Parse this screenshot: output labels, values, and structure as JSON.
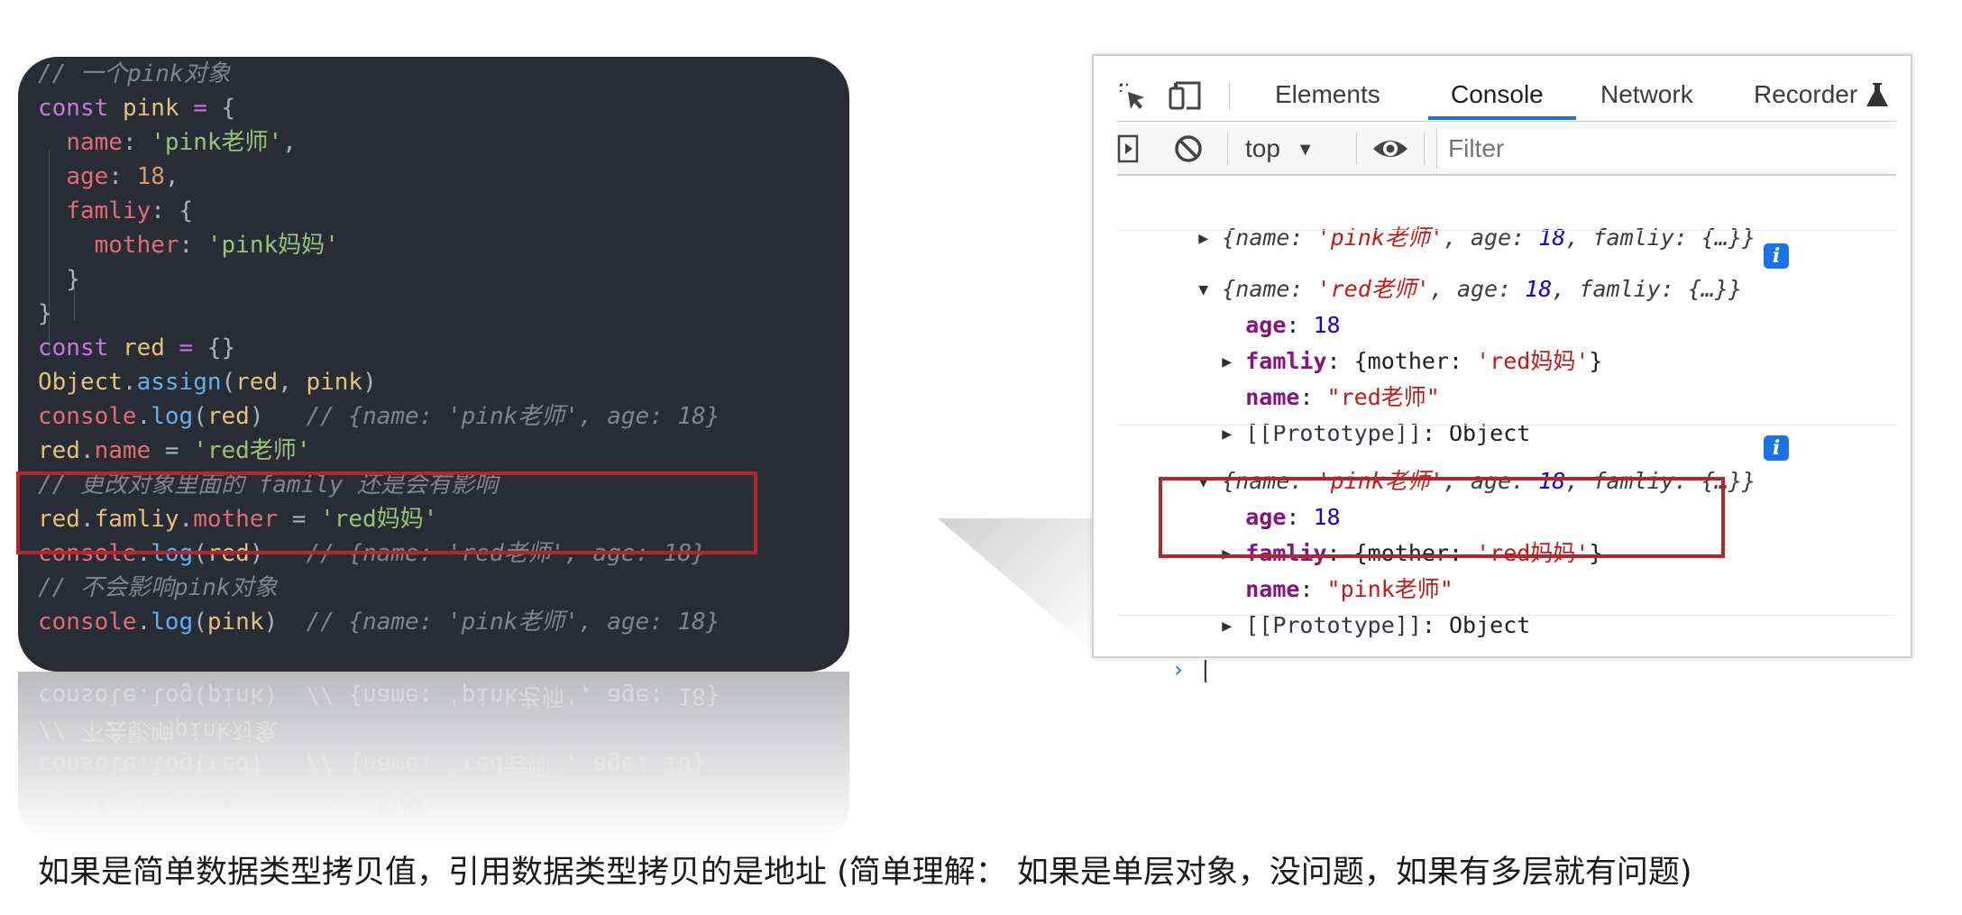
{
  "code": {
    "lines": [
      [
        {
          "t": "// 一个pink对象",
          "c": "cm"
        }
      ],
      [
        {
          "t": "const",
          "c": "kw"
        },
        {
          "t": " ",
          "c": "pun"
        },
        {
          "t": "pink",
          "c": "var"
        },
        {
          "t": " ",
          "c": "pun"
        },
        {
          "t": "=",
          "c": "kw"
        },
        {
          "t": " {",
          "c": "pun"
        }
      ],
      [
        {
          "t": "  ",
          "c": "pun"
        },
        {
          "t": "name",
          "c": "prop"
        },
        {
          "t": ": ",
          "c": "pun"
        },
        {
          "t": "'pink老师'",
          "c": "str"
        },
        {
          "t": ",",
          "c": "pun"
        }
      ],
      [
        {
          "t": "  ",
          "c": "pun"
        },
        {
          "t": "age",
          "c": "prop"
        },
        {
          "t": ": ",
          "c": "pun"
        },
        {
          "t": "18",
          "c": "num"
        },
        {
          "t": ",",
          "c": "pun"
        }
      ],
      [
        {
          "t": "  ",
          "c": "pun"
        },
        {
          "t": "famliy",
          "c": "prop"
        },
        {
          "t": ": {",
          "c": "pun"
        }
      ],
      [
        {
          "t": "    ",
          "c": "pun"
        },
        {
          "t": "mother",
          "c": "prop"
        },
        {
          "t": ": ",
          "c": "pun"
        },
        {
          "t": "'pink妈妈'",
          "c": "str"
        }
      ],
      [
        {
          "t": "  }",
          "c": "pun"
        }
      ],
      [
        {
          "t": "}",
          "c": "pun"
        }
      ],
      [
        {
          "t": "const",
          "c": "kw"
        },
        {
          "t": " ",
          "c": "pun"
        },
        {
          "t": "red",
          "c": "var"
        },
        {
          "t": " ",
          "c": "pun"
        },
        {
          "t": "=",
          "c": "kw"
        },
        {
          "t": " {}",
          "c": "pun"
        }
      ],
      [
        {
          "t": "Object",
          "c": "obj"
        },
        {
          "t": ".",
          "c": "pun"
        },
        {
          "t": "assign",
          "c": "fn"
        },
        {
          "t": "(",
          "c": "pun"
        },
        {
          "t": "red",
          "c": "var"
        },
        {
          "t": ", ",
          "c": "pun"
        },
        {
          "t": "pink",
          "c": "var"
        },
        {
          "t": ")",
          "c": "pun"
        }
      ],
      [
        {
          "t": "console",
          "c": "prop"
        },
        {
          "t": ".",
          "c": "pun"
        },
        {
          "t": "log",
          "c": "fn"
        },
        {
          "t": "(",
          "c": "pun"
        },
        {
          "t": "red",
          "c": "var"
        },
        {
          "t": ")   ",
          "c": "pun"
        },
        {
          "t": "// {name: 'pink老师', age: 18}",
          "c": "cm"
        }
      ],
      [
        {
          "t": "red",
          "c": "var"
        },
        {
          "t": ".",
          "c": "pun"
        },
        {
          "t": "name",
          "c": "prop"
        },
        {
          "t": " = ",
          "c": "pun"
        },
        {
          "t": "'red老师'",
          "c": "str"
        }
      ],
      [
        {
          "t": "// 更改对象里面的 family 还是会有影响",
          "c": "cm"
        }
      ],
      [
        {
          "t": "red",
          "c": "var"
        },
        {
          "t": ".",
          "c": "pun"
        },
        {
          "t": "famliy",
          "c": "var"
        },
        {
          "t": ".",
          "c": "pun"
        },
        {
          "t": "mother",
          "c": "prop"
        },
        {
          "t": " = ",
          "c": "pun"
        },
        {
          "t": "'red妈妈'",
          "c": "str"
        }
      ],
      [
        {
          "t": "console",
          "c": "prop"
        },
        {
          "t": ".",
          "c": "pun"
        },
        {
          "t": "log",
          "c": "fn"
        },
        {
          "t": "(",
          "c": "pun"
        },
        {
          "t": "red",
          "c": "var"
        },
        {
          "t": ")   ",
          "c": "pun"
        },
        {
          "t": "// {name: 'red老师', age: 18}",
          "c": "cm"
        }
      ],
      [
        {
          "t": "// 不会影响pink对象",
          "c": "cm"
        }
      ],
      [
        {
          "t": "console",
          "c": "prop"
        },
        {
          "t": ".",
          "c": "pun"
        },
        {
          "t": "log",
          "c": "fn"
        },
        {
          "t": "(",
          "c": "pun"
        },
        {
          "t": "pink",
          "c": "var"
        },
        {
          "t": ")  ",
          "c": "pun"
        },
        {
          "t": "// {name: 'pink老师', age: 18}",
          "c": "cm"
        }
      ]
    ]
  },
  "devtools": {
    "tabs": [
      "Elements",
      "Console",
      "Network",
      "Recorder"
    ],
    "active_tab": "Console",
    "context_label": "top",
    "filter_placeholder": "Filter",
    "icons": {
      "inspect": "inspect-cursor-icon",
      "device": "device-toggle-icon",
      "recorder": "flask-icon",
      "sidebar": "sidebar-toggle-icon",
      "clear": "clear-console-icon",
      "dropdown": "dropdown-arrow-icon",
      "eye": "live-expression-eye-icon",
      "info": "info-icon"
    },
    "log1": {
      "arrow": "▶",
      "prefix": "{name: ",
      "name_val": "'pink老师'",
      "mid": ", age: ",
      "age_val": "18",
      "suffix": ", famliy: {…}}"
    },
    "log2": {
      "arrow": "▼",
      "prefix": "{name: ",
      "name_val": "'red老师'",
      "mid": ", age: ",
      "age_val": "18",
      "suffix": ", famliy: {…}}",
      "age_key": "age",
      "age_value": "18",
      "famliy_key": "famliy",
      "famliy_open": ": {mother: ",
      "famliy_val": "'red妈妈'",
      "famliy_close": "}",
      "name_key": "name",
      "name_value": "\"red老师\"",
      "proto_key": "[[Prototype]]",
      "proto_value": ": Object"
    },
    "log3": {
      "arrow": "▼",
      "prefix": "{name: ",
      "name_val": "'pink老师'",
      "mid": ", age: ",
      "age_val": "18",
      "suffix": ", famliy: {…}}",
      "age_key": "age",
      "age_value": "18",
      "famliy_key": "famliy",
      "famliy_open": ": {mother: ",
      "famliy_val": "'red妈妈'",
      "famliy_close": "}",
      "name_key": "name",
      "name_value": "\"pink老师\"",
      "proto_key": "[[Prototype]]",
      "proto_value": ": Object"
    },
    "prompt": "›"
  },
  "colors": {
    "code_bg": "#282c34",
    "highlight_box": "#b3262d",
    "devtools_accent": "#1a73e8"
  },
  "caption": "如果是简单数据类型拷贝值，引用数据类型拷贝的是地址 (简单理解： 如果是单层对象，没问题，如果有多层就有问题)"
}
